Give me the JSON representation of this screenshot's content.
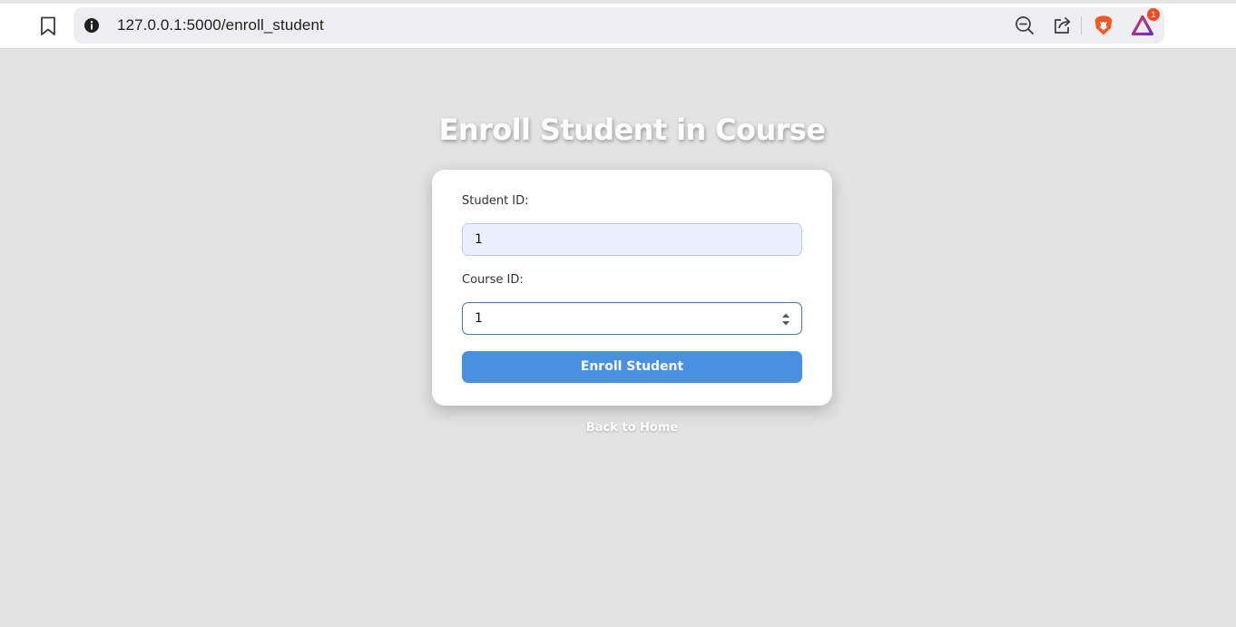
{
  "browser": {
    "url": "127.0.0.1:5000/enroll_student",
    "rewards_badge_count": "1"
  },
  "page": {
    "title": "Enroll Student in Course",
    "form": {
      "student_id_label": "Student ID:",
      "student_id_value": "1",
      "course_id_label": "Course ID:",
      "course_id_value": "1",
      "submit_label": "Enroll Student"
    },
    "back_link": "Back to Home"
  },
  "icons": {
    "bookmark": "bookmark-icon",
    "site_info": "info-icon",
    "zoom": "zoom-out-icon",
    "share": "share-icon",
    "brave": "brave-shields-icon",
    "rewards": "brave-rewards-icon"
  },
  "colors": {
    "page_background": "#e3e3e3",
    "primary_button": "#4a90e2",
    "autofill_input": "#e8f0fe",
    "focused_border": "#4c78a8"
  }
}
